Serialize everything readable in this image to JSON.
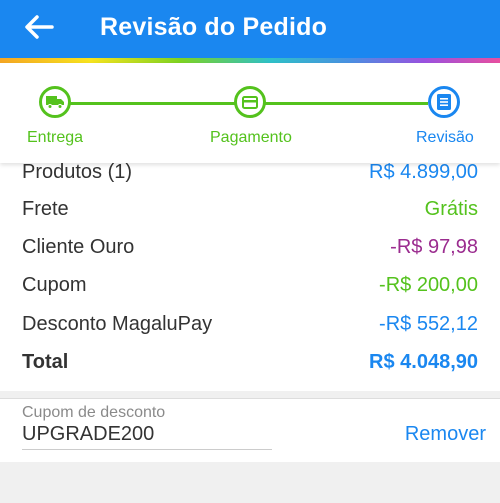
{
  "header": {
    "title": "Revisão do Pedido",
    "back_icon": "arrow-left-icon",
    "background": "#1a87f0"
  },
  "stepper": {
    "steps": [
      {
        "label": "Entrega",
        "icon": "truck-icon",
        "state": "done"
      },
      {
        "label": "Pagamento",
        "icon": "card-icon",
        "state": "done"
      },
      {
        "label": "Revisão",
        "icon": "document-icon",
        "state": "active"
      }
    ],
    "done_color": "#54c21d",
    "active_color": "#1a87f0"
  },
  "summary": {
    "rows": [
      {
        "label": "Produtos (1)",
        "value": "R$ 4.899,00",
        "color": "#1a87f0"
      },
      {
        "label": "Frete",
        "value": "Grátis",
        "color": "#54c21d"
      },
      {
        "label": "Cliente Ouro",
        "value": "-R$ 97,98",
        "color": "#9b2c8f"
      },
      {
        "label": "Cupom",
        "value": "-R$ 200,00",
        "color": "#54c21d"
      },
      {
        "label": "Desconto MagaluPay",
        "value": "-R$ 552,12",
        "color": "#1a87f0"
      }
    ],
    "total": {
      "label": "Total",
      "value": "R$ 4.048,90",
      "color": "#1a87f0"
    }
  },
  "coupon": {
    "caption": "Cupom de desconto",
    "code": "UPGRADE200",
    "remove_label": "Remover"
  }
}
